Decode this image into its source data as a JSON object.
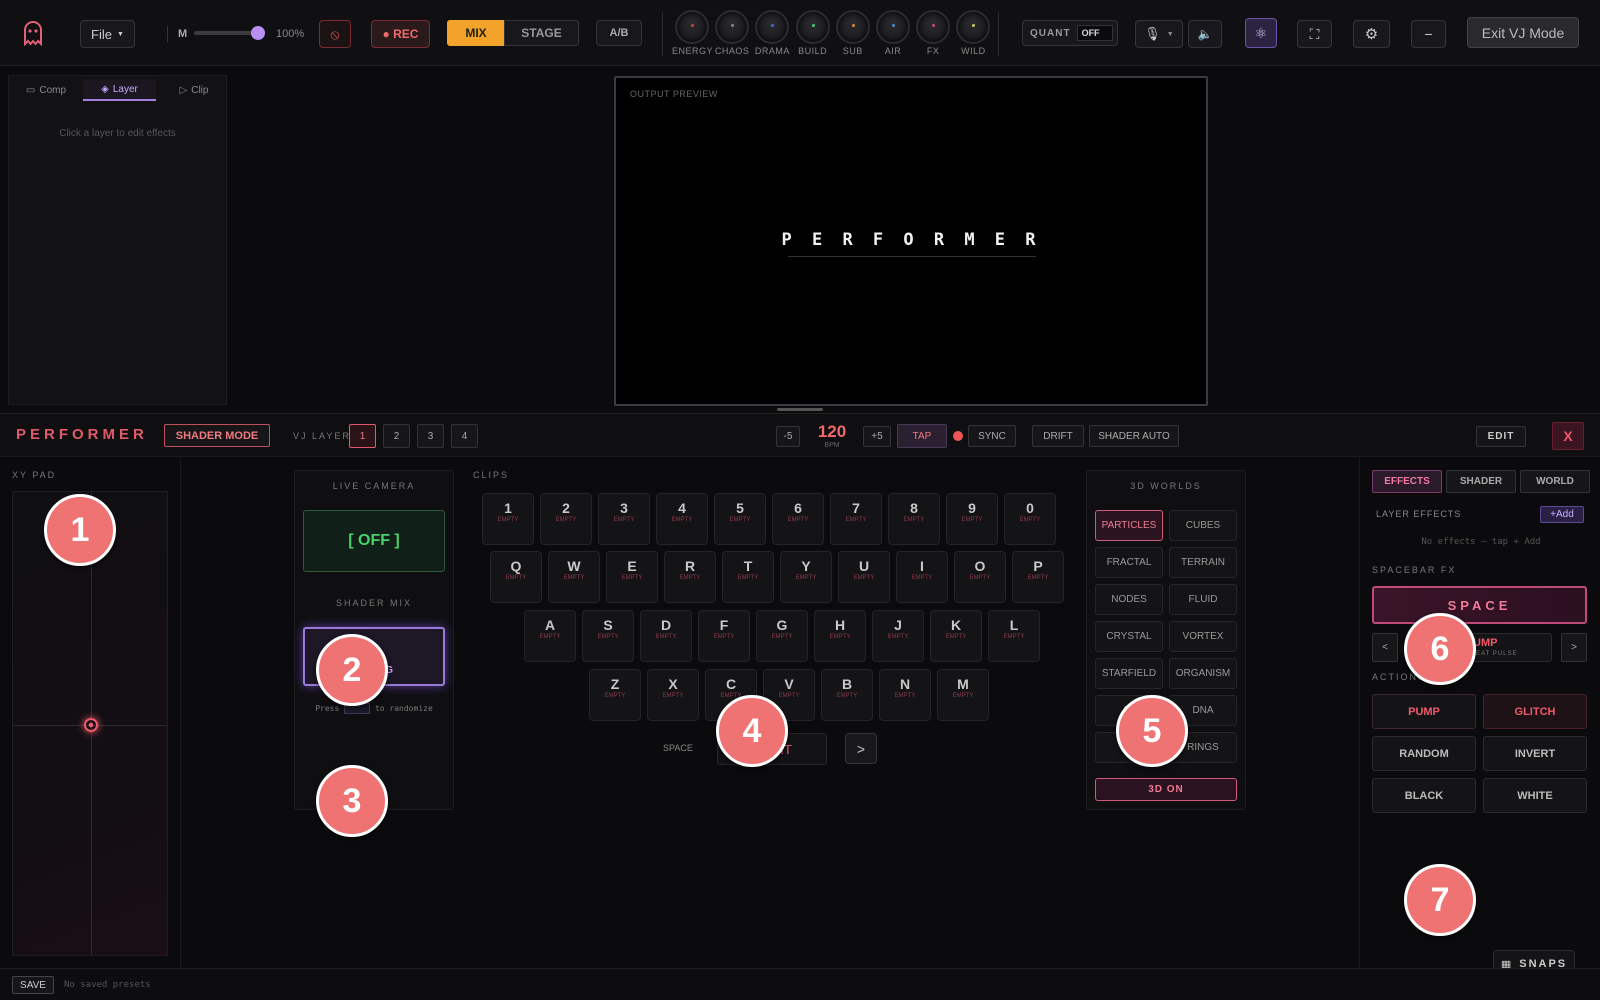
{
  "topbar": {
    "file_label": "File",
    "master_label": "M",
    "master_value": 1.0,
    "master_pct": "100%",
    "rec_label": "● REC",
    "mix_label": "MIX",
    "stage_label": "STAGE",
    "ab_label": "A/B",
    "knobs": [
      {
        "label": "ENERGY",
        "color": "#c94a3a"
      },
      {
        "label": "CHAOS",
        "color": "#888888"
      },
      {
        "label": "DRAMA",
        "color": "#4a6ac9"
      },
      {
        "label": "BUILD",
        "color": "#4ac96a"
      },
      {
        "label": "SUB",
        "color": "#c98a3a"
      },
      {
        "label": "AIR",
        "color": "#4a8ac9"
      },
      {
        "label": "FX",
        "color": "#c94a6a"
      },
      {
        "label": "WILD",
        "color": "#c9c94a"
      }
    ],
    "quant_label": "QUANT",
    "quant_value": "OFF",
    "exit_label": "Exit VJ Mode"
  },
  "left_panel": {
    "tabs": [
      "Comp",
      "Layer",
      "Clip"
    ],
    "empty_hint": "Click a layer to edit effects"
  },
  "preview": {
    "label": "OUTPUT PREVIEW",
    "title": "P E R F O R M E R"
  },
  "performer": {
    "logo": "PERFORMER",
    "shader_mode": "SHADER MODE",
    "vj_layer_label": "VJ LAYER",
    "layers": [
      "1",
      "2",
      "3",
      "4"
    ],
    "bpm_minus": "-5",
    "bpm": "120",
    "bpm_unit": "BPM",
    "bpm_plus": "+5",
    "tap": "TAP",
    "sync": "SYNC",
    "drift": "DRIFT",
    "shader_auto": "SHADER AUTO",
    "edit": "EDIT",
    "close": "X"
  },
  "xy_pad": {
    "label": "XY PAD"
  },
  "camera": {
    "label": "LIVE CAMERA",
    "state": "[ OFF ]",
    "shader_mix_label": "SHADER MIX",
    "shader_mix_partial": "G",
    "hint_prefix": "Press",
    "hint_suffix": "to randomize"
  },
  "clips": {
    "label": "CLIPS",
    "empty": "EMPTY",
    "row1": [
      "1",
      "2",
      "3",
      "4",
      "5",
      "6",
      "7",
      "8",
      "9",
      "0"
    ],
    "row2": [
      "Q",
      "W",
      "E",
      "R",
      "T",
      "Y",
      "U",
      "I",
      "O",
      "P"
    ],
    "row3": [
      "A",
      "S",
      "D",
      "F",
      "G",
      "H",
      "J",
      "K",
      "L"
    ],
    "row4": [
      "Z",
      "X",
      "C",
      "V",
      "B",
      "N",
      "M"
    ],
    "space_label": "SPACE",
    "space_value": "ORBIT",
    "next": ">"
  },
  "worlds": {
    "label": "3D WORLDS",
    "items": [
      "PARTICLES",
      "CUBES",
      "FRACTAL",
      "TERRAIN",
      "NODES",
      "FLUID",
      "CRYSTAL",
      "VORTEX",
      "STARFIELD",
      "ORGANISM",
      "AU",
      "DNA",
      "S",
      "RINGS"
    ],
    "toggle": "3D ON"
  },
  "right_panel": {
    "tabs": [
      "EFFECTS",
      "SHADER",
      "WORLD"
    ],
    "layer_effects": "LAYER EFFECTS",
    "add": "+Add",
    "empty": "No effects — tap + Add",
    "spacebar_label": "SPACEBAR FX",
    "space": "SPACE",
    "prev": "<",
    "next": ">",
    "fx_name": "UMP",
    "fx_sub": "BEAT PULSE",
    "actions_label": "ACTIONS",
    "actions": [
      "PUMP",
      "GLITCH",
      "RANDOM",
      "INVERT",
      "BLACK",
      "WHITE"
    ],
    "snaps": "SNAPS"
  },
  "footer": {
    "save": "SAVE",
    "status": "No saved presets"
  },
  "markers": [
    "1",
    "2",
    "3",
    "4",
    "5",
    "6",
    "7"
  ]
}
